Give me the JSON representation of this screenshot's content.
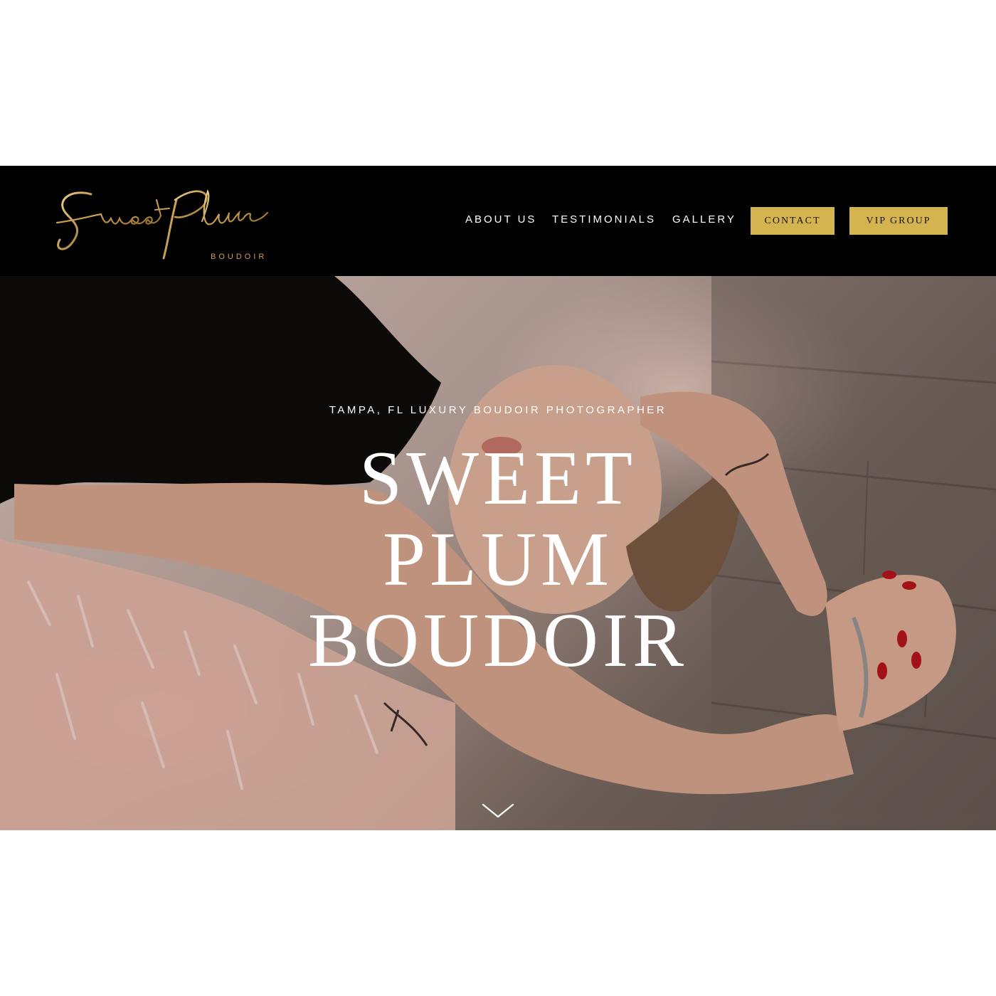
{
  "header": {
    "logo": {
      "script_text": "Sweet Plum",
      "subtitle": "BOUDOIR",
      "color": "#c79f55"
    },
    "nav": {
      "about_label": "ABOUT US",
      "testimonials_label": "TESTIMONIALS",
      "gallery_label": "GALLERY",
      "contact_label": "CONTACT",
      "vip_label": "VIP GROUP"
    },
    "background_color": "#000000",
    "button_color": "#d4b450"
  },
  "hero": {
    "kicker": "TAMPA, FL LUXURY BOUDOIR PHOTOGRAPHER",
    "title_lines": [
      "SWEET",
      "PLUM",
      "BOUDOIR"
    ],
    "scroll_icon": "chevron-down-icon"
  }
}
